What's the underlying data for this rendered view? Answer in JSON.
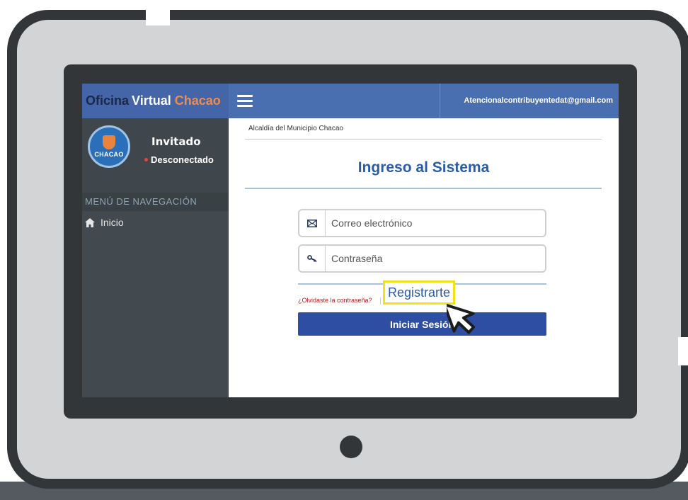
{
  "app": {
    "brand_part1": "Oficina",
    "brand_part2": "Virtual",
    "brand_part3": "Chacao",
    "email": "Atencionalcontribuyentedat@gmail.com",
    "avatar_logo_text": "CHACAO"
  },
  "sidebar": {
    "user_name": "Invitado",
    "user_status": "Desconectado",
    "nav_header": "MENÚ DE NAVEGACIÓN",
    "items": [
      {
        "label": "Inicio",
        "icon": "home-icon"
      }
    ]
  },
  "main": {
    "breadcrumb": "Alcaldía del Municipio Chacao",
    "title": "Ingreso al Sistema",
    "email_placeholder": "Correo electrónico",
    "password_placeholder": "Contraseña",
    "forgot_label": "¿Olvidaste la contraseña?",
    "register_label": "Registrarte",
    "login_label": "Iniciar Sesión"
  },
  "colors": {
    "topbar": "#4a6fb1",
    "sidebar": "#434a4f",
    "accent_orange": "#ef8c4f",
    "title_blue": "#2b5ca8",
    "button_blue": "#2e4ea3",
    "highlight_yellow": "#f2e21a",
    "frame": "#333639"
  }
}
